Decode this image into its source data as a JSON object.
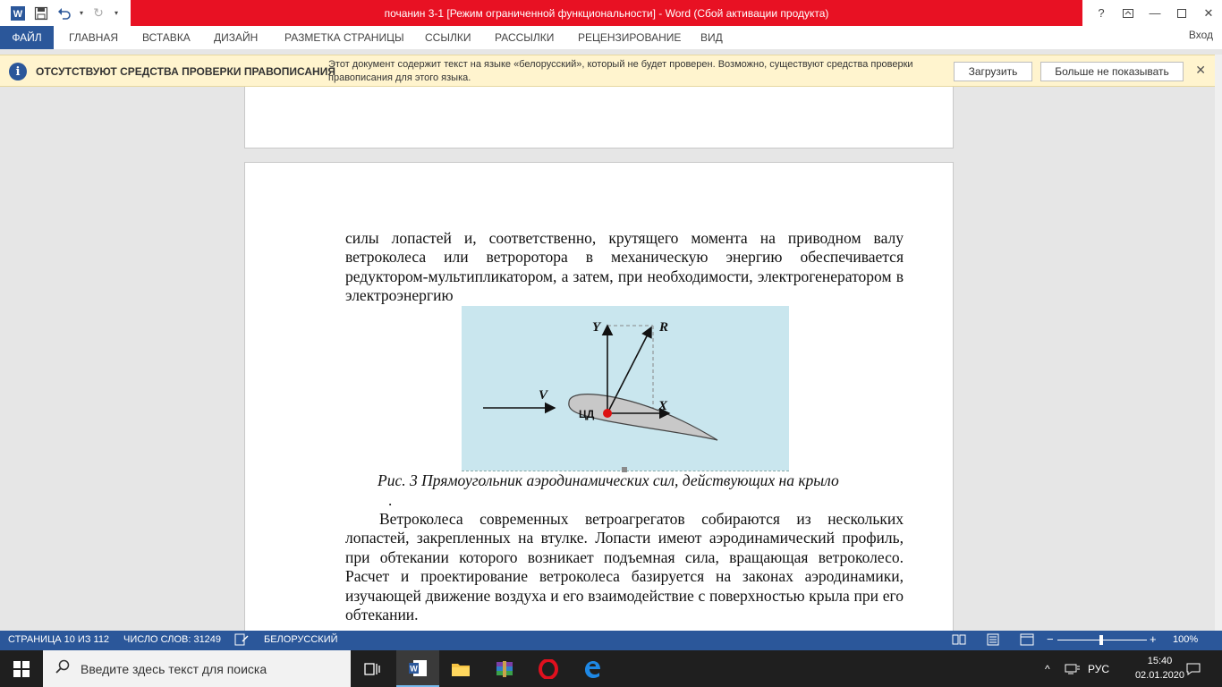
{
  "window": {
    "title": "почанин 3-1 [Режим ограниченной функциональности]  -  Word (Сбой активации продукта)"
  },
  "ribbon": {
    "tabs": [
      "ФАЙЛ",
      "ГЛАВНАЯ",
      "ВСТАВКА",
      "ДИЗАЙН",
      "РАЗМЕТКА СТРАНИЦЫ",
      "ССЫЛКИ",
      "РАССЫЛКИ",
      "РЕЦЕНЗИРОВАНИЕ",
      "ВИД"
    ],
    "signin": "Вход"
  },
  "message_bar": {
    "title": "ОТСУТСТВУЮТ СРЕДСТВА ПРОВЕРКИ ПРАВОПИСАНИЯ",
    "text": "Этот документ содержит текст на языке «белорусский», который не будет проверен. Возможно, существуют средства проверки правописания для этого языка.",
    "download_label": "Загрузить",
    "dismiss_label": "Больше не показывать"
  },
  "document": {
    "para1": "силы лопастей и, соответственно, крутящего момента на приводном валу ветроколеса или ветроротора в механическую энергию обеспечивается редуктором-мультипликатором, а затем, при необходимости, электрогенератором в электроэнергию",
    "figure_labels": {
      "y": "Y",
      "r": "R",
      "v": "V",
      "x": "X",
      "cd": "ЦД"
    },
    "caption": "Рис. 3 Прямоугольник аэродинамических сил, действующих на крыло",
    "dot": ".",
    "para2": "Ветроколеса современных ветроагрегатов собираются из нескольких лопастей, закрепленных на втулке. Лопасти имеют аэродинамический профиль, при обтекании которого возникает подъемная сила, вращающая ветроколесо. Расчет и проектирование ветроколеса базируется на законах аэродинамики, изучающей движение воздуха и его взаимодействие с поверхностью крыла при его обтекании."
  },
  "statusbar": {
    "page": "СТРАНИЦА 10 ИЗ 112",
    "words": "ЧИСЛО СЛОВ: 31249",
    "language": "БЕЛОРУССКИЙ",
    "zoom": "100%"
  },
  "taskbar": {
    "search_placeholder": "Введите здесь текст для поиска",
    "language": "РУС",
    "time": "15:40",
    "date": "02.01.2020"
  },
  "colors": {
    "word_blue": "#2b579a",
    "title_red": "#e81123",
    "message_bg": "#fff4ce",
    "figure_bg": "#c9e6ee"
  }
}
